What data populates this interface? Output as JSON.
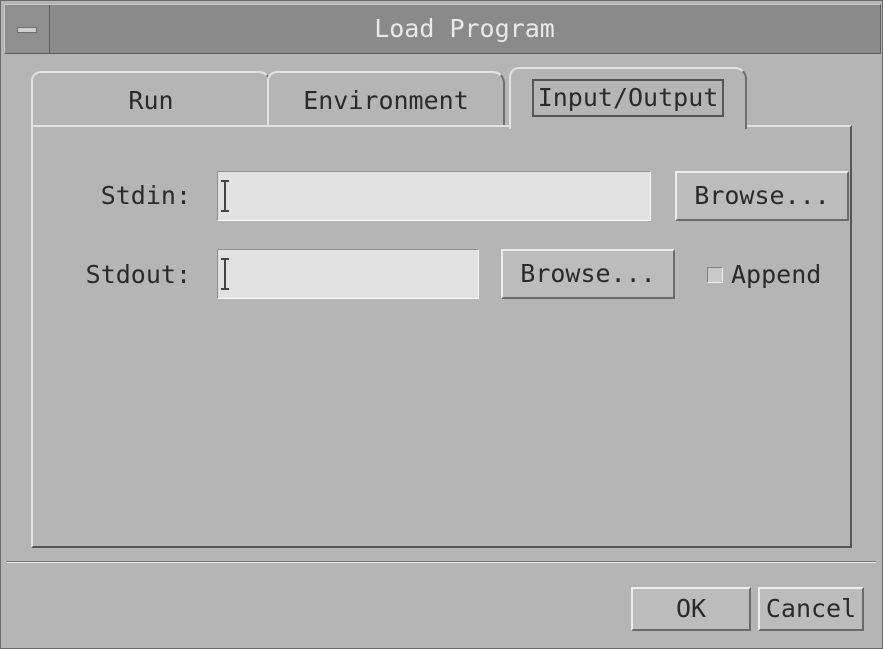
{
  "window": {
    "title": "Load Program"
  },
  "tabs": {
    "run": "Run",
    "environment": "Environment",
    "io": "Input/Output"
  },
  "io": {
    "stdin_label": "Stdin:",
    "stdin_value": "",
    "stdin_browse": "Browse...",
    "stdout_label": "Stdout:",
    "stdout_value": "",
    "stdout_browse": "Browse...",
    "append_label": "Append",
    "append_checked": false
  },
  "footer": {
    "ok": "OK",
    "cancel": "Cancel"
  }
}
